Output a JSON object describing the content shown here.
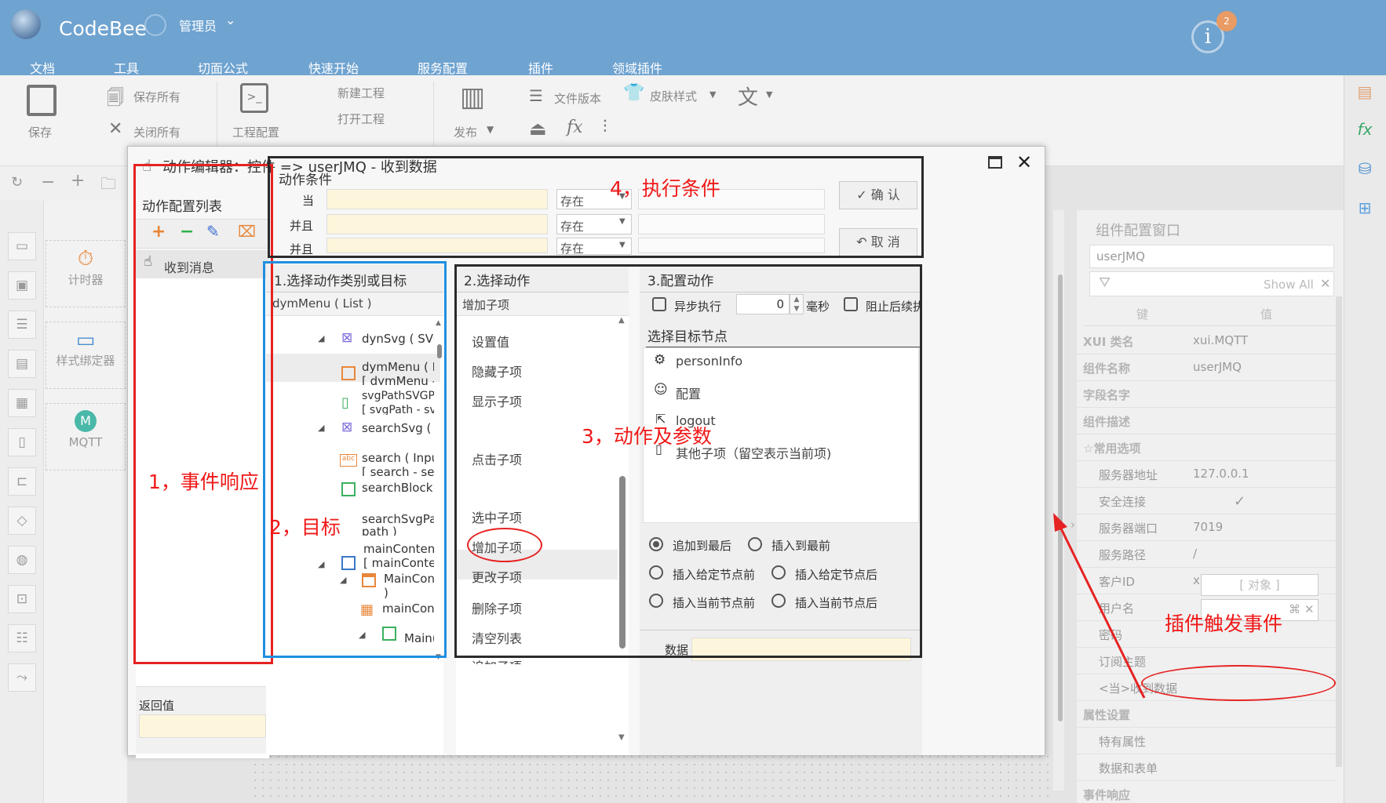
{
  "app": {
    "title": "CodeBee",
    "user": "管理员",
    "notif_count": "2"
  },
  "menu": [
    "文档",
    "工具",
    "切面公式",
    "快速开始",
    "服务配置",
    "插件",
    "领域插件"
  ],
  "toolbar": {
    "save": "保存",
    "save_all": "保存所有",
    "close_all": "关闭所有",
    "project_config": "工程配置",
    "new_project": "新建工程",
    "open_project": "打开工程",
    "publish": "发布",
    "file_version": "文件版本",
    "skin_style": "皮肤样式"
  },
  "palette": [
    "计时器",
    "样式绑定器",
    "MQTT"
  ],
  "dialog": {
    "title": "动作编辑器：控件 => userJMQ - 收到数据",
    "list_header": "动作配置列表",
    "list_items": [
      "收到消息"
    ],
    "return_label": "返回值",
    "cond_header": "动作条件",
    "cond_rows": [
      {
        "label": "当",
        "op": "存在"
      },
      {
        "label": "并且",
        "op": "存在"
      },
      {
        "label": "并且",
        "op": "存在"
      }
    ],
    "confirm": "确 认",
    "cancel": "取 消",
    "panel1_header": "1.选择动作类别或目标",
    "panel1_sub": "dymMenu ( List )",
    "tree": [
      "dynSvg ( SVG",
      "dymMenu ( Li",
      "[ dymMenu - ]",
      "svgPathSVGPa",
      "[ svgPath - sv",
      "searchSvg ( S",
      "search ( Input",
      "[ search - sear",
      "searchBlock (",
      "searchSvgPath",
      "path )",
      "mainContent_",
      "[ mainConten",
      "MainCont",
      ")",
      "mainConte",
      "Main("
    ],
    "panel2_header": "2.选择动作",
    "panel2_sub": "增加子项",
    "actions": [
      "设置值",
      "隐藏子项",
      "显示子项",
      "点击子项",
      "选中子项",
      "增加子项",
      "更改子项",
      "删除子项",
      "清空列表",
      "追加子项"
    ],
    "panel3_header": "3.配置动作",
    "async_label": "异步执行",
    "delay_value": "0",
    "ms_label": "毫秒",
    "stop_label": "阻止后续执",
    "target_header": "选择目标节点",
    "targets": [
      "personInfo",
      "配置",
      "logout",
      "其他子项（留空表示当前项)"
    ],
    "radios": [
      "追加到最后",
      "插入到最前",
      "插入给定节点前",
      "插入给定节点后",
      "插入当前节点前",
      "插入当前节点后"
    ],
    "data_label": "数据"
  },
  "annotations": {
    "a1": "1，事件响应",
    "a2": "2，目标",
    "a3": "3，动作及参数",
    "a4": "4，执行条件",
    "plugin": "插件触发事件"
  },
  "config": {
    "title": "组件配置窗口",
    "name_value": "userJMQ",
    "show_all": "Show All",
    "col_key": "键",
    "col_val": "值",
    "rows": [
      {
        "k": "XUI 类名",
        "v": "xui.MQTT",
        "bold": true
      },
      {
        "k": "组件名称",
        "v": "userJMQ",
        "bold": true
      },
      {
        "k": "字段名字",
        "v": "",
        "bold": true
      },
      {
        "k": "组件描述",
        "v": "",
        "bold": true
      },
      {
        "k": "☆常用选项",
        "v": "",
        "bold": true
      },
      {
        "k": "服务器地址",
        "v": "127.0.0.1"
      },
      {
        "k": "安全连接",
        "v": "✓"
      },
      {
        "k": "服务器端口",
        "v": "7019"
      },
      {
        "k": "服务路径",
        "v": "/"
      },
      {
        "k": "客户ID",
        "v": "xui_mqtt_client"
      },
      {
        "k": "用户名",
        "v": ""
      },
      {
        "k": "密码",
        "v": ""
      },
      {
        "k": "订阅主题",
        "v": "[ 对象 ]"
      },
      {
        "k": "<当>收到数据",
        "v": ""
      },
      {
        "k": "属性设置",
        "v": "",
        "bold": true
      },
      {
        "k": "特有属性",
        "v": ""
      },
      {
        "k": "数据和表单",
        "v": ""
      },
      {
        "k": "事件响应",
        "v": "",
        "bold": true
      }
    ]
  },
  "colors": {
    "accent": "#6fa3d0",
    "annotation": "#e62222",
    "target_box": "#1f8fe0",
    "yellow_field": "#fdf6dc"
  }
}
